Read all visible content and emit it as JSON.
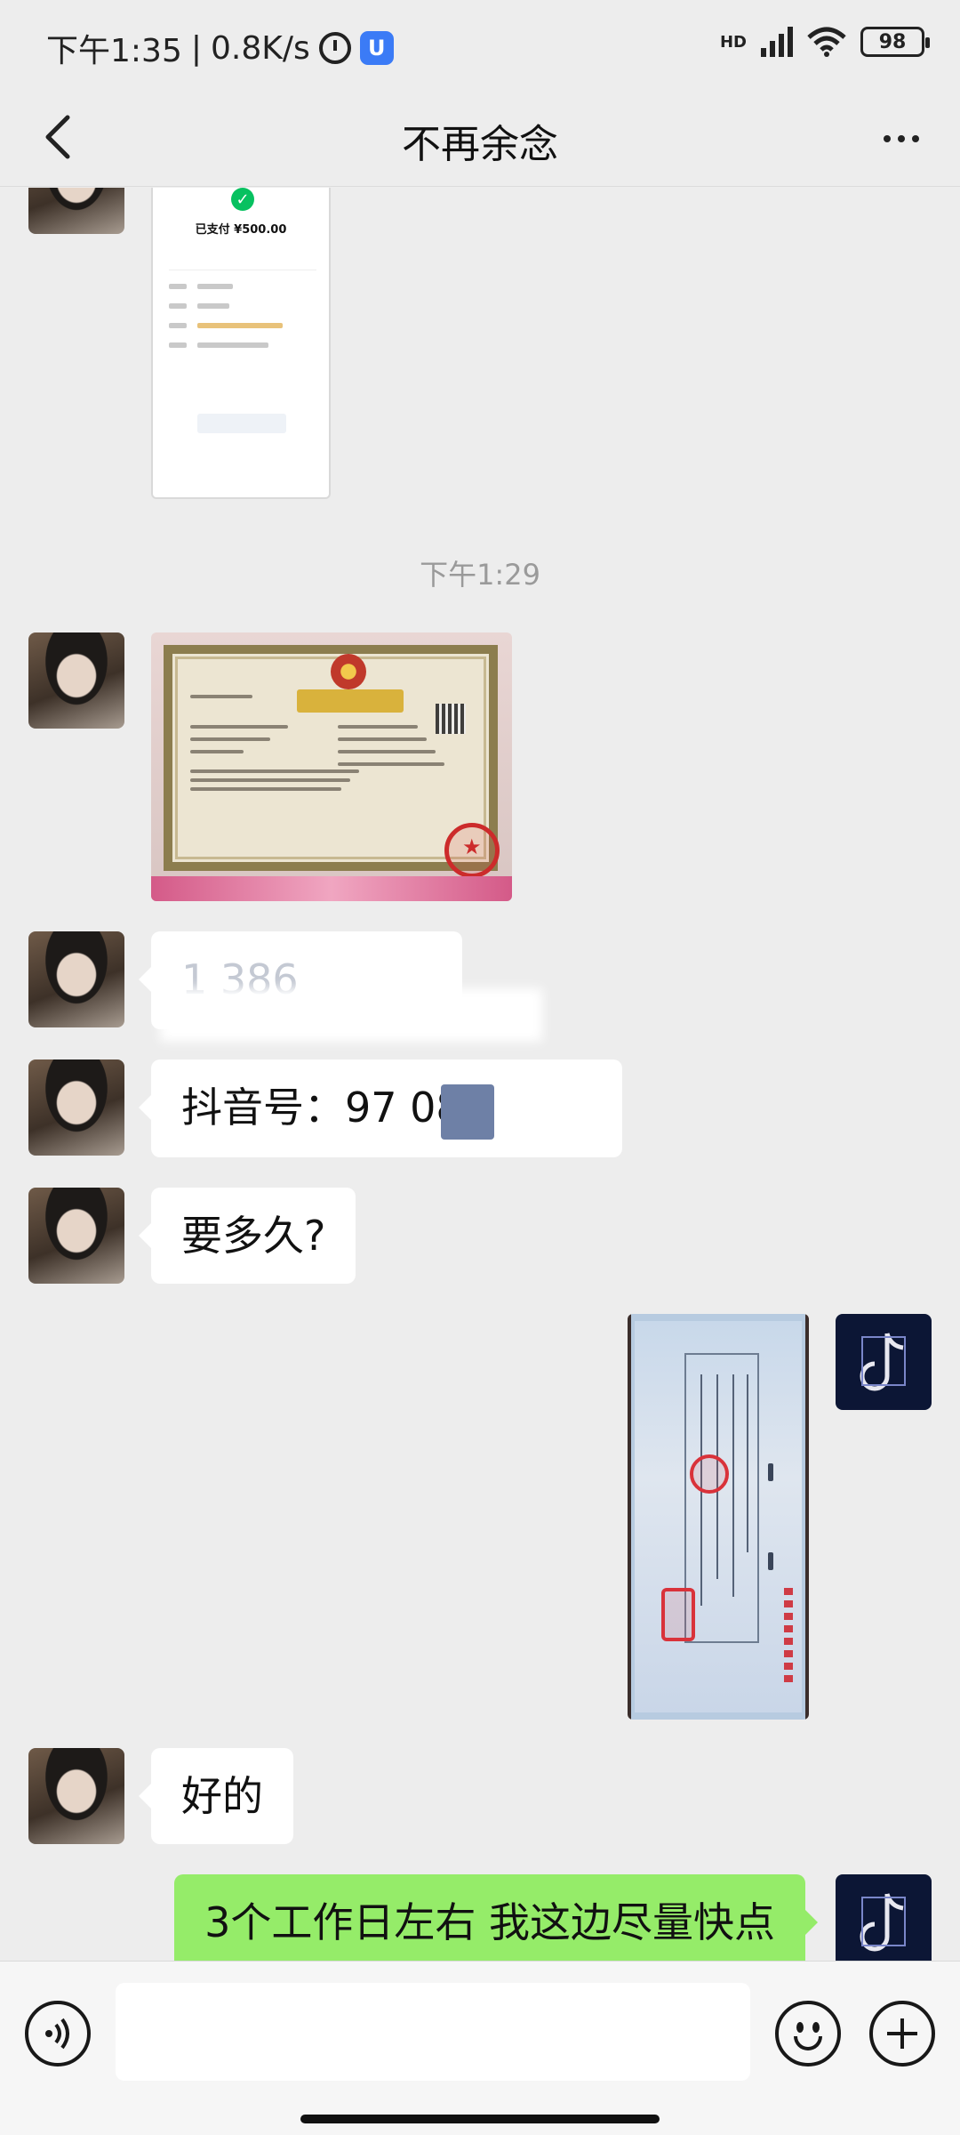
{
  "status_bar": {
    "time": "下午1:35",
    "network_speed": "0.8K/s",
    "signal_label": "HD",
    "battery": "98"
  },
  "header": {
    "title": "不再余念"
  },
  "payment_screenshot": {
    "amount_text": "已支付 ¥500.00"
  },
  "timestamps": [
    "下午1:29"
  ],
  "messages": {
    "phone_number": "1        386",
    "douyin_id": "抖音号：97      086",
    "question": "要多久?",
    "ok": "好的",
    "reply": "3个工作日左右 我这边尽量快点"
  },
  "colors": {
    "background": "#ededed",
    "bubble_incoming": "#ffffff",
    "bubble_outgoing": "#95ec69",
    "accent_green": "#07c160"
  }
}
